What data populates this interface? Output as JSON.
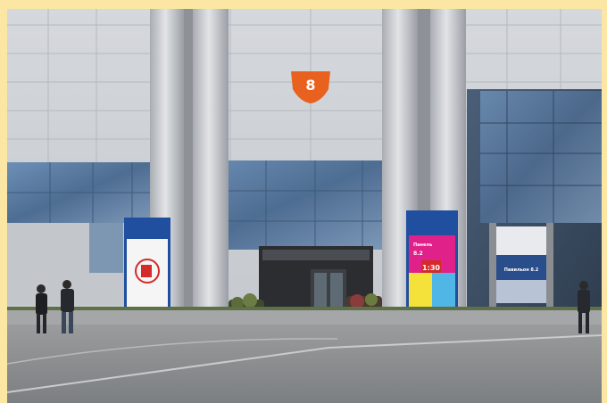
{
  "photo": {
    "hall_number": "8",
    "banner_center": {
      "line1": "Панель",
      "line2": "8.2",
      "line3": "1:30"
    },
    "banner_right": {
      "line1": "Павильон 8.2"
    },
    "colors": {
      "frame": "#fbe7a3",
      "facade_panel": "#c9ccd1",
      "glass": "#5f7fa6",
      "hall_badge": "#e8611f",
      "pavement": "#8b8f92",
      "banner_blue": "#1f4f9e",
      "banner_pink": "#e0218a",
      "banner_yellow": "#f4e23a"
    }
  }
}
